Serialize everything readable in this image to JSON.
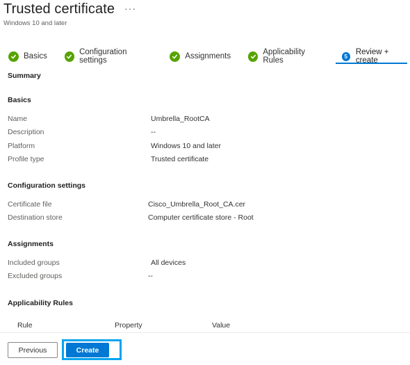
{
  "header": {
    "title": "Trusted certificate",
    "more": "···",
    "subtitle": "Windows 10 and later"
  },
  "steps": [
    {
      "label": "Basics",
      "state": "complete"
    },
    {
      "label": "Configuration settings",
      "state": "complete"
    },
    {
      "label": "Assignments",
      "state": "complete"
    },
    {
      "label": "Applicability Rules",
      "state": "complete"
    },
    {
      "label": "Review + create",
      "state": "current",
      "number": "5"
    }
  ],
  "summary_heading": "Summary",
  "basics": {
    "heading": "Basics",
    "rows": [
      {
        "label": "Name",
        "value": "Umbrella_RootCA"
      },
      {
        "label": "Description",
        "value": "--"
      },
      {
        "label": "Platform",
        "value": "Windows 10 and later"
      },
      {
        "label": "Profile type",
        "value": "Trusted certificate"
      }
    ]
  },
  "configuration": {
    "heading": "Configuration settings",
    "rows": [
      {
        "label": "Certificate file",
        "value": "Cisco_Umbrella_Root_CA.cer"
      },
      {
        "label": "Destination store",
        "value": "Computer certificate store - Root"
      }
    ]
  },
  "assignments": {
    "heading": "Assignments",
    "rows": [
      {
        "label": "Included groups",
        "value": "All devices"
      },
      {
        "label": "Excluded groups",
        "value": "--"
      }
    ]
  },
  "applicability": {
    "heading": "Applicability Rules",
    "columns": [
      "Rule",
      "Property",
      "Value"
    ]
  },
  "footer": {
    "previous_label": "Previous",
    "create_label": "Create"
  },
  "colors": {
    "accent": "#0078d4",
    "success": "#57a300",
    "focus": "#00a4ef"
  }
}
